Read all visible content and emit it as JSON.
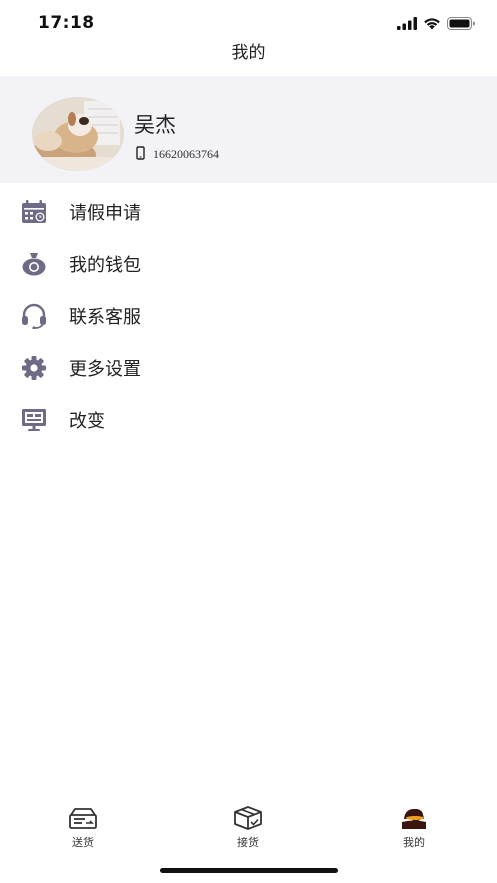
{
  "status_bar": {
    "time": "17:18",
    "icons": [
      "signal-icon",
      "wifi-icon",
      "battery-icon"
    ]
  },
  "header": {
    "title": "我的"
  },
  "profile": {
    "name": "吴杰",
    "phone": "16620063764",
    "avatar": "avatar-photo-dog",
    "background_color": "#f3f2f7"
  },
  "menu": {
    "icon_color": "#6f6b86",
    "items": [
      {
        "label": "请假申请",
        "icon": "calendar-icon"
      },
      {
        "label": "我的钱包",
        "icon": "money-bag-icon"
      },
      {
        "label": "联系客服",
        "icon": "headset-icon"
      },
      {
        "label": "更多设置",
        "icon": "gear-icon"
      },
      {
        "label": "改变",
        "icon": "monitor-icon"
      }
    ]
  },
  "tabbar": {
    "tabs": [
      {
        "label": "送货",
        "icon": "delivery-truck-icon",
        "active": false
      },
      {
        "label": "接货",
        "icon": "package-icon",
        "active": false
      },
      {
        "label": "我的",
        "icon": "user-icon",
        "active": true
      }
    ],
    "active_color": "#3a1510"
  }
}
